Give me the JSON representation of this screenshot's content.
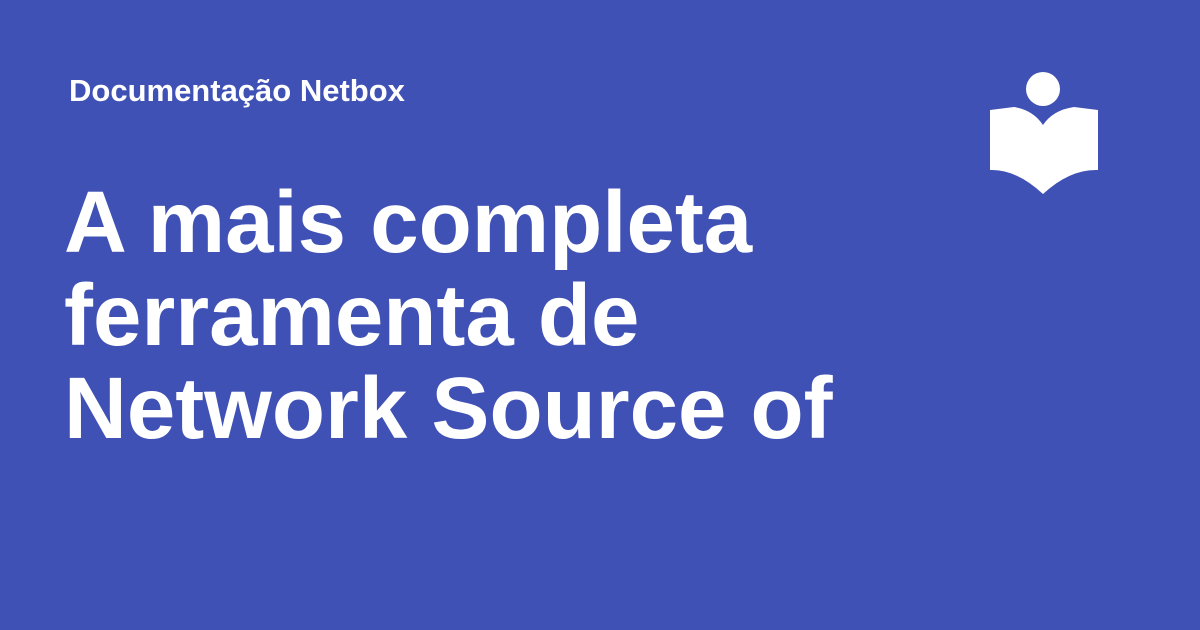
{
  "site": {
    "name": "Documentação Netbox"
  },
  "page": {
    "title_lines": [
      "A mais completa",
      "ferramenta de",
      "Network Source of"
    ]
  },
  "theme": {
    "background": "#4051b5",
    "foreground": "#ffffff"
  },
  "logo": {
    "icon": "reader-book-icon"
  }
}
